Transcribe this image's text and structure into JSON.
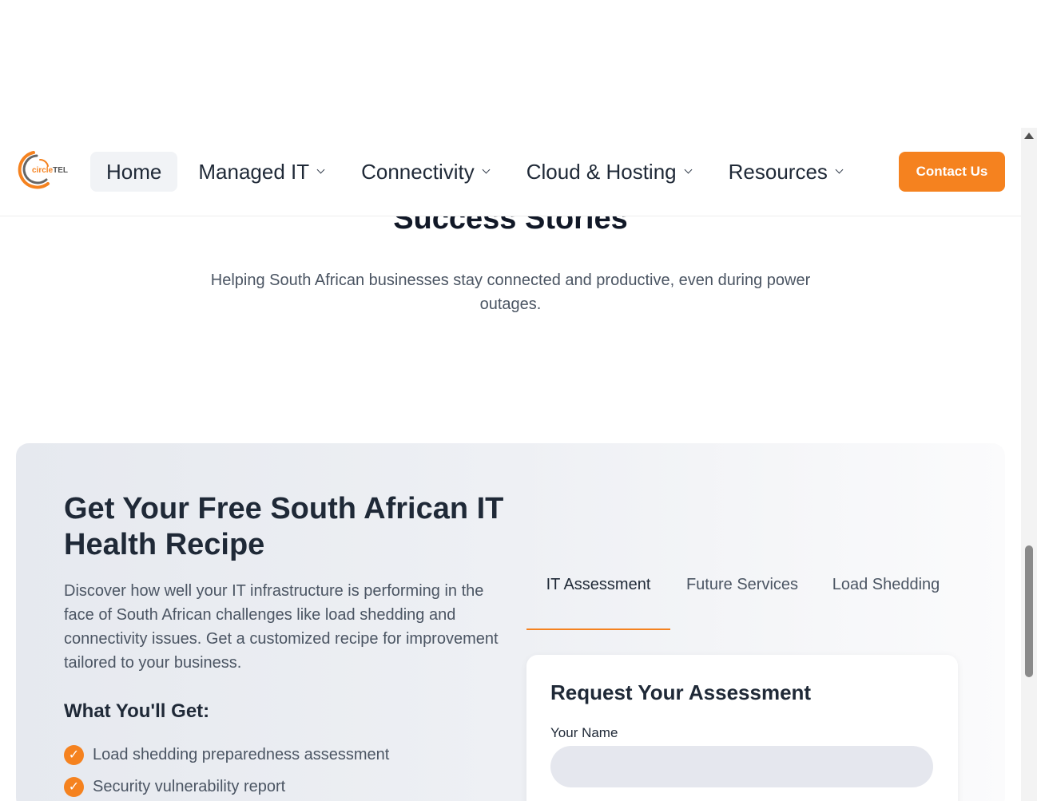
{
  "header": {
    "logo_text_a": "circle",
    "logo_text_b": "TEL",
    "nav": [
      {
        "label": "Home"
      },
      {
        "label": "Managed IT"
      },
      {
        "label": "Connectivity"
      },
      {
        "label": "Cloud & Hosting"
      },
      {
        "label": "Resources"
      }
    ],
    "contact_label": "Contact Us"
  },
  "success": {
    "title": "Success Stories",
    "subtitle": "Helping South African businesses stay connected and productive, even during power outages."
  },
  "recipe": {
    "title": "Get Your Free South African IT Health Recipe",
    "description": "Discover how well your IT infrastructure is performing in the face of South African challenges like load shedding and connectivity issues. Get a customized recipe for improvement tailored to your business.",
    "get_title": "What You'll Get:",
    "benefits": [
      "Load shedding preparedness assessment",
      "Security vulnerability report"
    ],
    "tabs": [
      {
        "label": "IT Assessment"
      },
      {
        "label": "Future Services"
      },
      {
        "label": "Load Shedding"
      }
    ],
    "form": {
      "title": "Request Your Assessment",
      "name_label": "Your Name",
      "name_value": ""
    }
  },
  "colors": {
    "accent": "#f5821f",
    "text_dark": "#1f2937",
    "text_muted": "#4b5563"
  },
  "icons": {
    "check": "check-circle-icon",
    "chevron": "chevron-down-icon"
  }
}
